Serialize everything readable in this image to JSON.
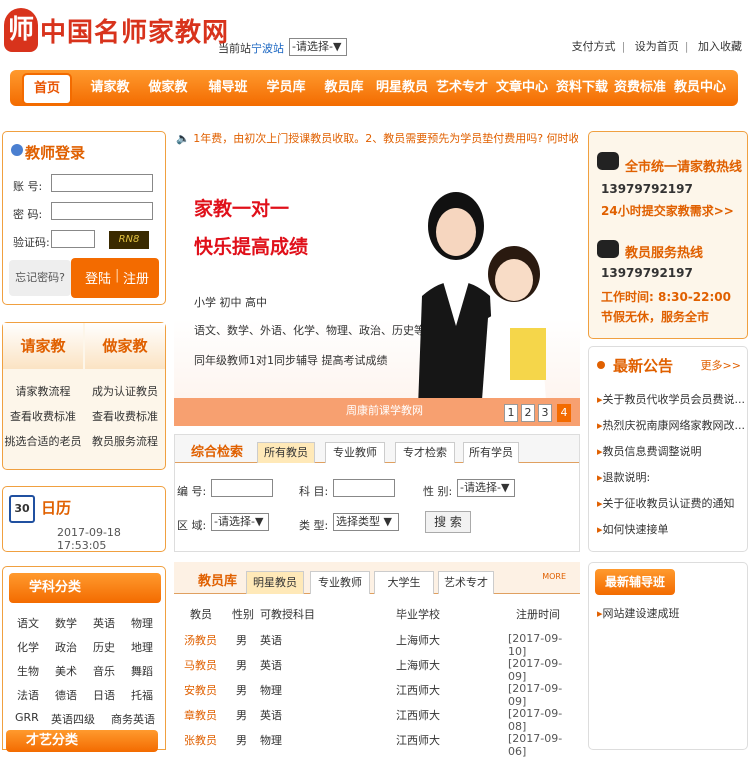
{
  "header": {
    "logo_char": "师",
    "site_name": "中国名师家教网",
    "station_label": "当前站",
    "station_city": "宁波站",
    "city_select": "-请选择-▼",
    "links": [
      "支付方式",
      "设为首页",
      "加入收藏"
    ]
  },
  "nav": [
    "首页",
    "请家教",
    "做家教",
    "辅导班",
    "学员库",
    "教员库",
    "明星教员",
    "艺术专才",
    "文章中心",
    "资料下载",
    "资费标准",
    "教员中心"
  ],
  "login": {
    "title": "教师登录",
    "account": "账 号:",
    "password": "密 码:",
    "code": "验证码:",
    "captcha": "RN8",
    "forget": "忘记密码?",
    "login": "登陆",
    "register": "注册"
  },
  "hire": {
    "left_title": "请家教",
    "right_title": "做家教",
    "left": [
      "请家教流程",
      "查看收费标准",
      "挑选合适的老员"
    ],
    "right": [
      "成为认证教员",
      "查看收费标准",
      "教员服务流程"
    ]
  },
  "calendar": {
    "icon": "30",
    "title": "日历",
    "datetime": "2017-09-18 17:53:05"
  },
  "subjects": {
    "title": "学科分类",
    "items": [
      "语文",
      "数学",
      "英语",
      "物理",
      "化学",
      "政治",
      "历史",
      "地理",
      "生物",
      "美术",
      "音乐",
      "舞蹈",
      "法语",
      "德语",
      "日语",
      "托福",
      "GRR",
      "英语四级",
      "商务英语"
    ]
  },
  "art_title": "才艺分类",
  "notice": "1年费，由初次上门授课教员收取。2、教员需要预先为学员垫付费用吗? 何时收回?",
  "banner": {
    "h1": "家教一对一",
    "h2": "快乐提高成绩",
    "levels": "小学    初中    高中",
    "subjects": "语文、数学、外语、化学、物理、政治、历史等",
    "desc": "同年级教师1对1同步辅导 提高考试成绩",
    "caption": "周康前课学教网",
    "pages": [
      "1",
      "2",
      "3",
      "4"
    ]
  },
  "search": {
    "title": "综合检索",
    "tabs": [
      "所有教员",
      "专业教师",
      "专才检索",
      "所有学员"
    ],
    "f_no": "编 号:",
    "f_subject": "科 目:",
    "f_gender": "性 别:",
    "gender_val": "-请选择-▼",
    "f_area": "区 域:",
    "area_val": "-请选择-▼",
    "f_type": "类 型:",
    "type_val": "选择类型 ▼",
    "btn": "搜 索"
  },
  "teachers": {
    "title": "教员库",
    "tabs": [
      "明星教员",
      "专业教师",
      "大学生",
      "艺术专才"
    ],
    "more": "MORE",
    "headers": [
      "教员",
      "性别",
      "可教授科目",
      "毕业学校",
      "注册时间"
    ],
    "rows": [
      [
        "汤教员",
        "男",
        "英语",
        "上海师大",
        "[2017-09-10]"
      ],
      [
        "马教员",
        "男",
        "英语",
        "上海师大",
        "[2017-09-09]"
      ],
      [
        "安教员",
        "男",
        "物理",
        "江西师大",
        "[2017-09-09]"
      ],
      [
        "章教员",
        "男",
        "英语",
        "江西师大",
        "[2017-09-08]"
      ],
      [
        "张教员",
        "男",
        "物理",
        "江西师大",
        "[2017-09-06]"
      ]
    ]
  },
  "hotline": {
    "t1": "全市统一请家教热线",
    "n1": "13979792197",
    "o1": "24小时提交家教需求>>",
    "t2": "教员服务热线",
    "n2": "13979792197",
    "o2": "工作时间: 8:30-22:00",
    "o3": "节假无休，服务全市"
  },
  "announce": {
    "title": "最新公告",
    "more": "更多>>",
    "items": [
      "关于教员代收学员会员费说...",
      "热烈庆祝南康网络家教网改...",
      "教员信息费调整说明",
      "退款说明:",
      "关于征收教员认证费的通知",
      "如何快速接单"
    ]
  },
  "latest": {
    "title": "最新辅导班",
    "item": "网站建设速成班"
  }
}
